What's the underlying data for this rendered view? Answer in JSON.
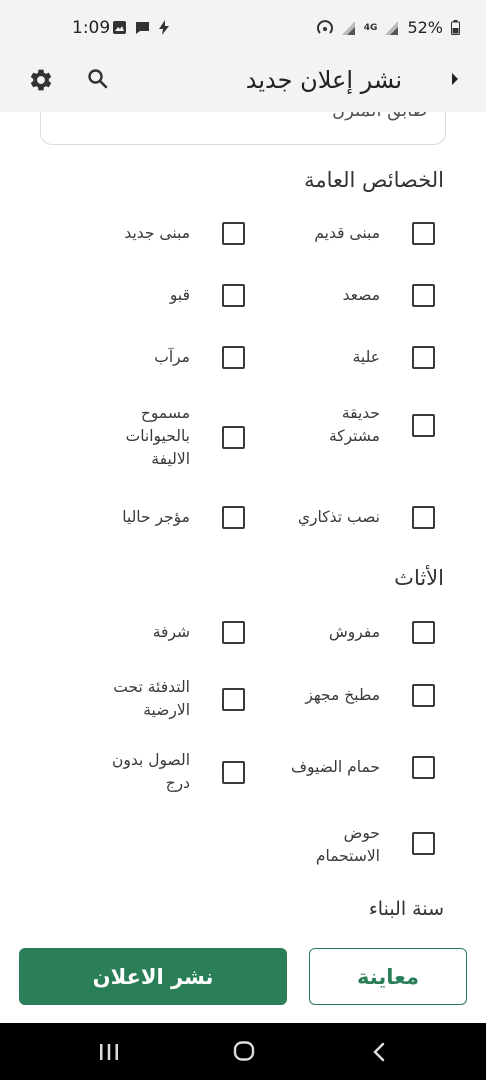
{
  "status_bar": {
    "time": "1:09",
    "battery": "52%",
    "network": "4G"
  },
  "app_bar": {
    "title": "نشر إعلان جديد"
  },
  "field_partial": {
    "value": "طابق المنزل"
  },
  "general_features": {
    "title": "الخصائص العامة",
    "items": [
      {
        "label": "مبنى قديم",
        "checked": false
      },
      {
        "label": "مبنى جديد",
        "checked": false
      },
      {
        "label": "مصعد",
        "checked": false
      },
      {
        "label": "قبو",
        "checked": false
      },
      {
        "label": "علية",
        "checked": false
      },
      {
        "label": "مرآب",
        "checked": false
      },
      {
        "label": "حديقة مشتركة",
        "checked": false
      },
      {
        "label": "مسموح بالحيوانات الاليفة",
        "checked": false
      },
      {
        "label": "نصب تذكاري",
        "checked": false
      },
      {
        "label": "مؤجر حاليا",
        "checked": false
      }
    ]
  },
  "furniture": {
    "title": "الأثاث",
    "items": [
      {
        "label": "مفروش",
        "checked": false
      },
      {
        "label": "شرفة",
        "checked": false
      },
      {
        "label": "مطبخ مجهز",
        "checked": false
      },
      {
        "label": "التدفئة تحت الارضية",
        "checked": false
      },
      {
        "label": "حمام الضيوف",
        "checked": false
      },
      {
        "label": "الصول بدون درج",
        "checked": false
      },
      {
        "label": "حوض الاستحمام",
        "checked": false
      }
    ]
  },
  "build_year": {
    "title": "سنة البناء"
  },
  "actions": {
    "publish_label": "نشر الاعلان",
    "preview_label": "معاينة"
  },
  "colors": {
    "accent": "#2a7f59",
    "appbar_bg": "#f3f3f3"
  }
}
